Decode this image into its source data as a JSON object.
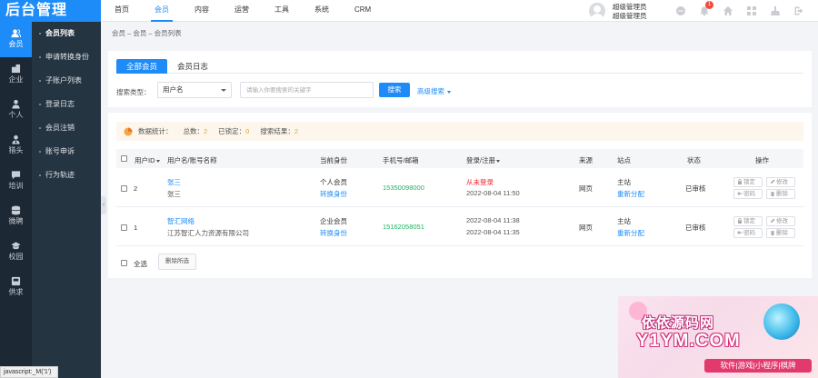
{
  "brand": {
    "title": "后台管理"
  },
  "topnav": [
    "首页",
    "会员",
    "内容",
    "运营",
    "工具",
    "系统",
    "CRM"
  ],
  "user": {
    "name": "超级管理员",
    "role": "超级管理员"
  },
  "notifications": {
    "count": "1"
  },
  "iconbar": [
    {
      "label": "会员",
      "icon": "user-icon"
    },
    {
      "label": "企业",
      "icon": "building-icon"
    },
    {
      "label": "个人",
      "icon": "person-icon"
    },
    {
      "label": "猎头",
      "icon": "headhunter-icon"
    },
    {
      "label": "培训",
      "icon": "chat-icon"
    },
    {
      "label": "微聘",
      "icon": "database-icon"
    },
    {
      "label": "校园",
      "icon": "graduation-icon"
    },
    {
      "label": "供求",
      "icon": "box-icon"
    }
  ],
  "submenu": [
    "会员列表",
    "申请转换身份",
    "子账户列表",
    "登录日志",
    "会员注销",
    "账号申诉",
    "行为轨迹"
  ],
  "breadcrumb": "会员 – 会员 – 会员列表",
  "tabs": [
    "全部会员",
    "会员日志"
  ],
  "search": {
    "label": "搜索类型：",
    "type_value": "用户名",
    "placeholder": "请输入你要搜索的关键字",
    "button": "搜索",
    "advanced": "高级搜索"
  },
  "stats": {
    "title": "数据统计：",
    "total_label": "总数：",
    "total": "2",
    "locked_label": "已锁定：",
    "locked": "0",
    "result_label": "搜索结果：",
    "result": "2"
  },
  "table": {
    "headers": {
      "uid": "用户ID",
      "name": "用户名/账号名称",
      "identity": "当前身份",
      "phone": "手机号/邮箱",
      "login": "登录/注册",
      "source": "来源",
      "site": "站点",
      "status": "状态",
      "ops": "操作"
    },
    "rows": [
      {
        "uid": "2",
        "name": "张三",
        "account": "张三",
        "identity": "个人会员",
        "switch": "转换身份",
        "phone": "15350098000",
        "login": "从未登录",
        "register": "2022-08-04 11:50",
        "source": "网页",
        "site": "主站",
        "redistribute": "重新分配",
        "status": "已审核"
      },
      {
        "uid": "1",
        "name": "智汇网络",
        "account": "江苏智汇人力资源有限公司",
        "identity": "企业会员",
        "switch": "转换身份",
        "phone": "15162058051",
        "login": "2022-08-04 11:38",
        "register": "2022-08-04 11:35",
        "source": "网页",
        "site": "主站",
        "redistribute": "重新分配",
        "status": "已审核"
      }
    ],
    "ops": {
      "lock": "锁定",
      "edit": "修改",
      "password": "密码",
      "delete": "删除"
    }
  },
  "footer": {
    "select_all": "全选",
    "bulk_delete": "删除所选"
  },
  "statusbar": "javascript:_M('1')",
  "watermark": {
    "cn": "依依源码网",
    "en": "Y1YM.COM",
    "tag": "软件|游戏|小程序|棋牌"
  },
  "colors": {
    "primary": "#1d8cf8",
    "sidebar": "#1c2833",
    "submenu": "#253441",
    "phone": "#20b463",
    "never_login": "#f5222d"
  }
}
